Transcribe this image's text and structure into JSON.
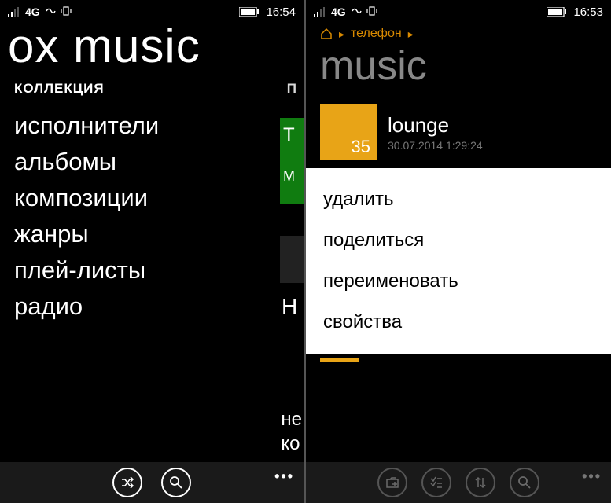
{
  "left": {
    "status": {
      "network": "4G",
      "time": "16:54"
    },
    "app_title": "ox music",
    "section_primary": "КОЛЛЕКЦИЯ",
    "section_secondary": "П",
    "menu": [
      "исполнители",
      "альбомы",
      "композиции",
      "жанры",
      "плей-листы",
      "радио"
    ],
    "peek_tile_lines": [
      "T",
      "M"
    ],
    "peek_text": "Н",
    "bottom_lines": [
      "не",
      "ко"
    ]
  },
  "right": {
    "status": {
      "network": "4G",
      "time": "16:53"
    },
    "breadcrumb": {
      "item": "телефон"
    },
    "page_title": "music",
    "folder": {
      "name": "lounge",
      "date": "30.07.2014 1:29:24",
      "count": "35"
    },
    "context_menu": [
      "удалить",
      "поделиться",
      "переименовать",
      "свойства"
    ]
  }
}
